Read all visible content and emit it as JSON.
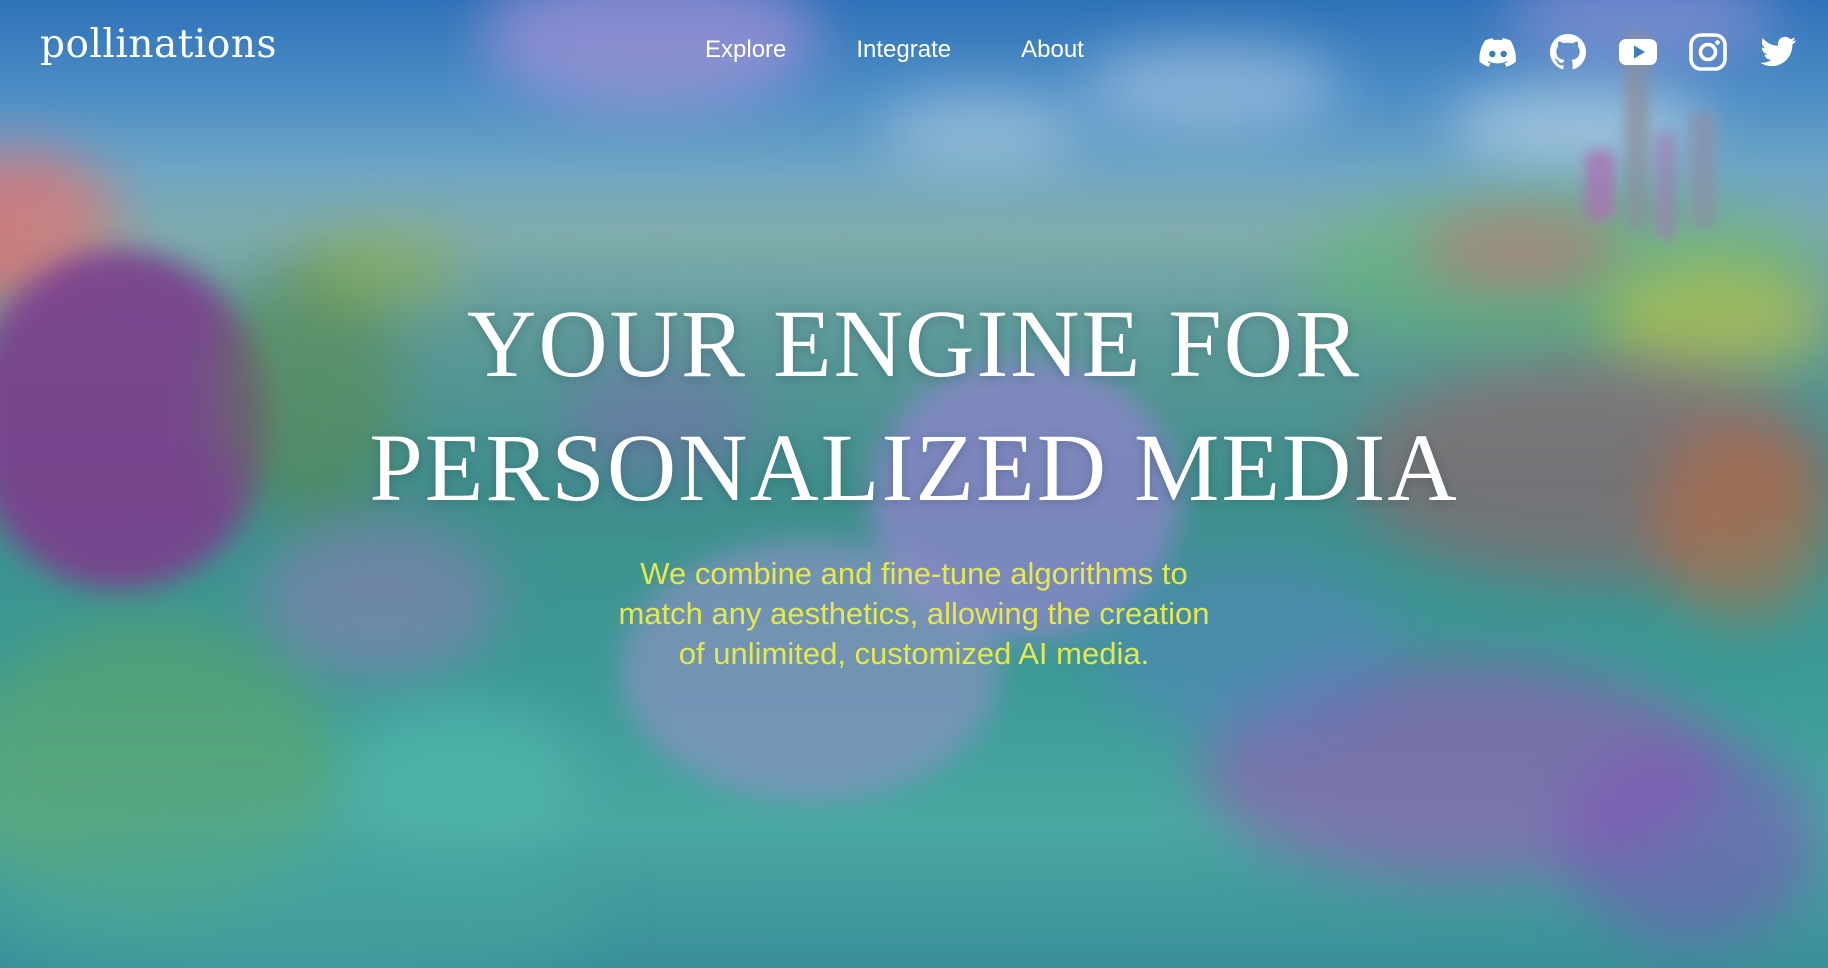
{
  "nav": {
    "logo": "pollinations",
    "links": [
      {
        "label": "Explore"
      },
      {
        "label": "Integrate"
      },
      {
        "label": "About"
      }
    ],
    "social_icons": [
      "discord-icon",
      "github-icon",
      "youtube-icon",
      "instagram-icon",
      "twitter-icon"
    ]
  },
  "hero": {
    "title_lines": [
      "YOUR ENGINE FOR",
      "PERSONALIZED MEDIA"
    ],
    "subtitle_lines": [
      "We combine and fine-tune algorithms to",
      "match any aesthetics, allowing the creation",
      "of unlimited, customized AI media."
    ]
  },
  "colors": {
    "text": "#ffffff",
    "accent": "#e3ea4a"
  }
}
